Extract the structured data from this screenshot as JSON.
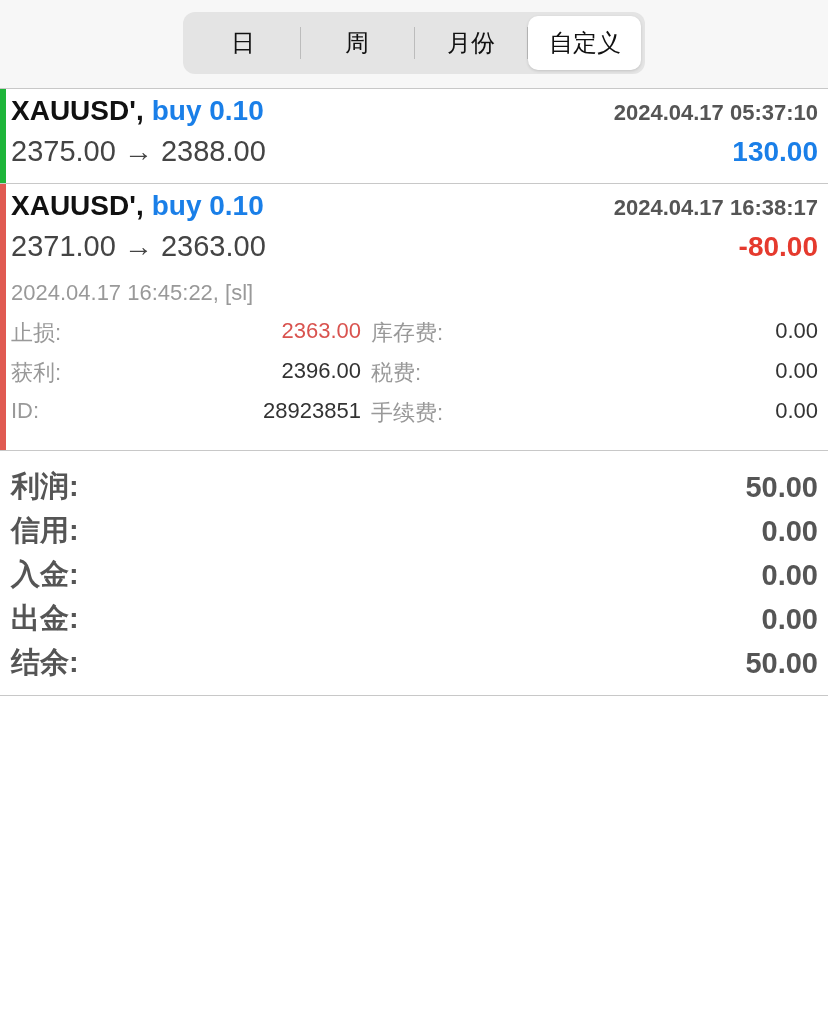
{
  "tabs": [
    {
      "label": "日",
      "selected": false
    },
    {
      "label": "周",
      "selected": false
    },
    {
      "label": "月份",
      "selected": false
    },
    {
      "label": "自定义",
      "selected": true
    }
  ],
  "trades": [
    {
      "symbol": "XAUUSD',",
      "action": "buy 0.10",
      "time": "2024.04.17 05:37:10",
      "prices": "2375.00 → 2388.00",
      "profit": "130.00",
      "loss": false,
      "expanded": false
    },
    {
      "symbol": "XAUUSD',",
      "action": "buy 0.10",
      "time": "2024.04.17 16:38:17",
      "prices": "2371.00 → 2363.00",
      "profit": "-80.00",
      "loss": true,
      "expanded": true,
      "close_info": "2024.04.17 16:45:22, [sl]",
      "fields": [
        {
          "label": "止损:",
          "value": "2363.00",
          "highlight": true
        },
        {
          "label": "库存费:",
          "value": "0.00",
          "highlight": false
        },
        {
          "label": "获利:",
          "value": "2396.00",
          "highlight": false
        },
        {
          "label": "税费:",
          "value": "0.00",
          "highlight": false
        },
        {
          "label": "ID:",
          "value": "28923851",
          "highlight": false
        },
        {
          "label": "手续费:",
          "value": "0.00",
          "highlight": false
        }
      ]
    }
  ],
  "summary": [
    {
      "label": "利润:",
      "value": "50.00"
    },
    {
      "label": "信用:",
      "value": "0.00"
    },
    {
      "label": "入金:",
      "value": "0.00"
    },
    {
      "label": "出金:",
      "value": "0.00"
    },
    {
      "label": "结余:",
      "value": "50.00"
    }
  ]
}
